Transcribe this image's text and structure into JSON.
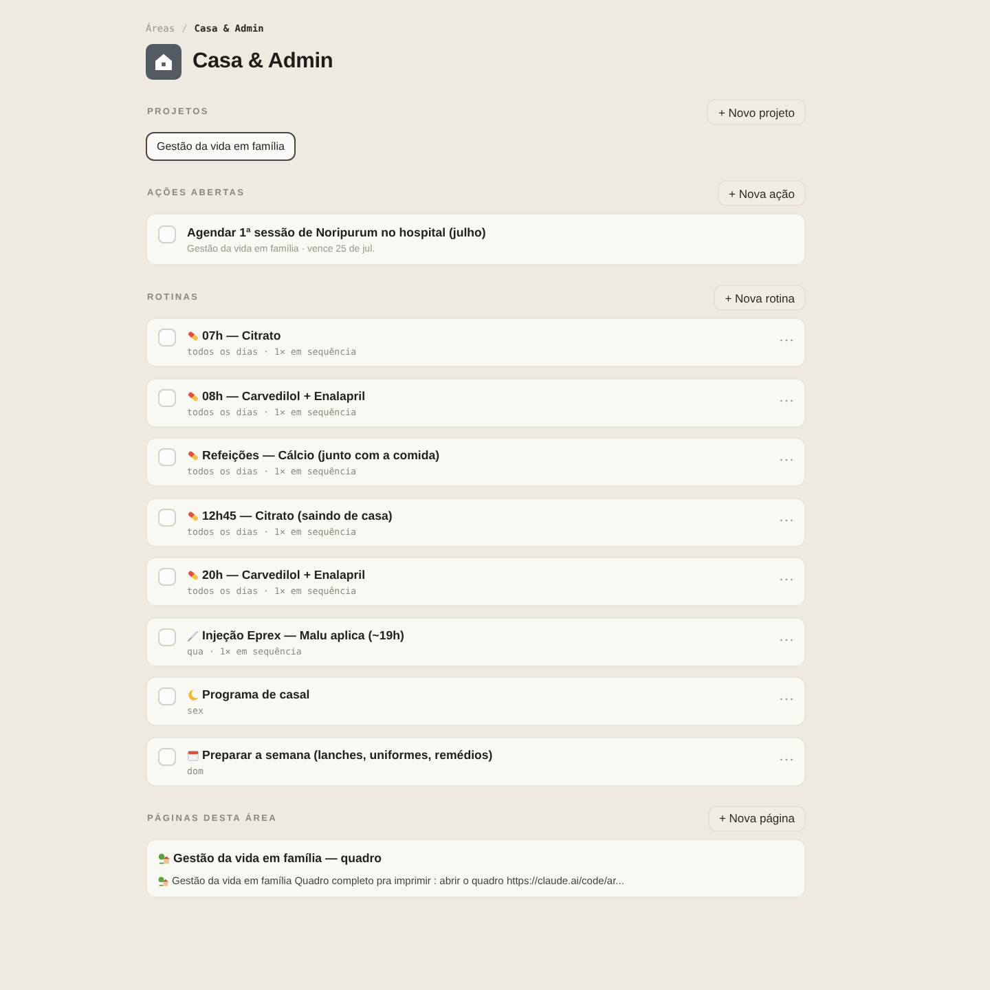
{
  "breadcrumb": {
    "separator": "/",
    "items": [
      {
        "label": "Áreas",
        "current": false
      },
      {
        "label": "Casa & Admin",
        "current": true
      }
    ]
  },
  "header": {
    "title": "Casa & Admin"
  },
  "projects": {
    "label": "PROJETOS",
    "button": "+ Novo projeto",
    "items": [
      {
        "name": "Gestão da vida em família"
      }
    ]
  },
  "open_actions": {
    "label": "AÇÕES ABERTAS",
    "button": "+ Nova ação",
    "items": [
      {
        "title": "Agendar 1ª sessão de Noripurum no hospital (julho)",
        "meta": "Gestão da vida em família · vence 25 de jul.",
        "checked": false
      }
    ]
  },
  "routines": {
    "label": "ROTINAS",
    "button": "+ Nova rotina",
    "items": [
      {
        "kind": "pill",
        "title": "07h — Citrato",
        "schedule": "todos os dias · 1× em sequência",
        "checked": false
      },
      {
        "kind": "pill",
        "title": "08h — Carvedilol + Enalapril",
        "schedule": "todos os dias · 1× em sequência",
        "checked": false
      },
      {
        "kind": "pill",
        "title": "Refeições — Cálcio (junto com a comida)",
        "schedule": "todos os dias · 1× em sequência",
        "checked": false
      },
      {
        "kind": "pill",
        "title": "12h45 — Citrato (saindo de casa)",
        "schedule": "todos os dias · 1× em sequência",
        "checked": false
      },
      {
        "kind": "pill",
        "title": "20h — Carvedilol + Enalapril",
        "schedule": "todos os dias · 1× em sequência",
        "checked": false
      },
      {
        "kind": "syringe",
        "title": "Injeção Eprex — Malu aplica (~19h)",
        "schedule": "qua · 1× em sequência",
        "checked": false
      },
      {
        "kind": "moon",
        "title": "Programa de casal",
        "schedule": "sex",
        "checked": false
      },
      {
        "kind": "calendar",
        "title": "Preparar a semana (lanches, uniformes, remédios)",
        "schedule": "dom",
        "checked": false
      }
    ]
  },
  "pages": {
    "label": "PÁGINAS DESTA ÁREA",
    "button": "+ Nova página",
    "items": [
      {
        "title": "Gestão da vida em família — quadro",
        "excerpt": "Gestão da vida em família Quadro completo pra imprimir : abrir o quadro https://claude.ai/code/ar..."
      }
    ]
  }
}
